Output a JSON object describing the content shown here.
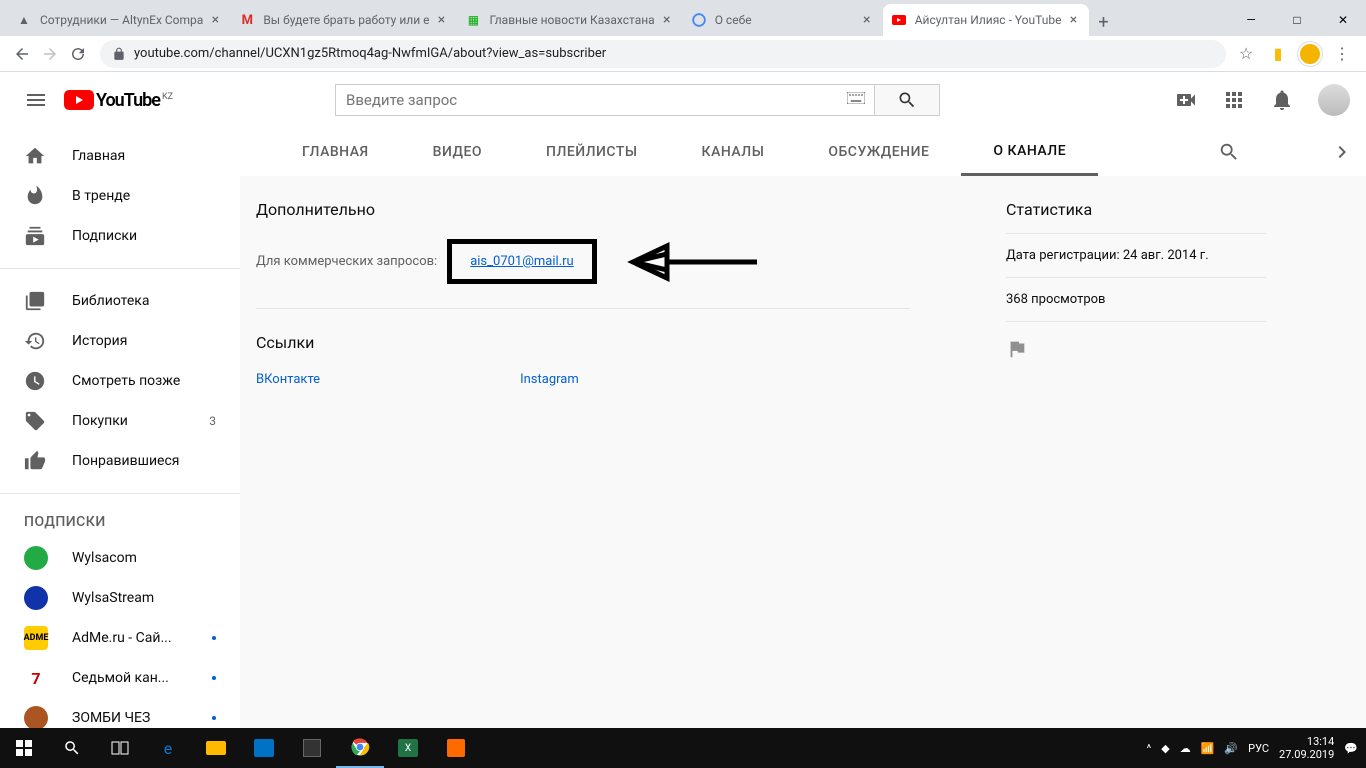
{
  "browser": {
    "tabs": [
      {
        "title": "Сотрудники — AltynEx Compa",
        "favicon": "altynex"
      },
      {
        "title": "Вы будете брать работу или е",
        "favicon": "gmail"
      },
      {
        "title": "Главные новости Казахстана",
        "favicon": "news"
      },
      {
        "title": "О себе",
        "favicon": "google"
      },
      {
        "title": "Айсултан Илияс - YouTube",
        "favicon": "youtube",
        "active": true
      }
    ],
    "url": "youtube.com/channel/UCXN1gz5Rtmoq4ag-NwfmIGA/about?view_as=subscriber"
  },
  "yt": {
    "logo_text": "YouTube",
    "logo_region": "KZ",
    "search_placeholder": "Введите запрос"
  },
  "sidebar": {
    "main": [
      {
        "icon": "home",
        "label": "Главная"
      },
      {
        "icon": "trending",
        "label": "В тренде"
      },
      {
        "icon": "subs",
        "label": "Подписки"
      }
    ],
    "lib": [
      {
        "icon": "library",
        "label": "Библиотека"
      },
      {
        "icon": "history",
        "label": "История"
      },
      {
        "icon": "later",
        "label": "Смотреть позже"
      },
      {
        "icon": "purchases",
        "label": "Покупки",
        "badge": "3"
      },
      {
        "icon": "liked",
        "label": "Понравившиеся"
      }
    ],
    "subs_title": "ПОДПИСКИ",
    "subs": [
      {
        "label": "Wylsacom",
        "color": "#2a4"
      },
      {
        "label": "WylsaStream",
        "color": "#13a"
      },
      {
        "label": "AdMe.ru - Сай...",
        "color": "#fc0",
        "dot": true
      },
      {
        "label": "Седьмой кан...",
        "color": "#c00",
        "dot": true
      },
      {
        "label": "ЗОМБИ ЧЕЗ",
        "color": "#a52",
        "dot": true
      }
    ]
  },
  "channel_tabs": [
    "ГЛАВНАЯ",
    "ВИДЕО",
    "ПЛЕЙЛИСТЫ",
    "КАНАЛЫ",
    "ОБСУЖДЕНИЕ",
    "О КАНАЛЕ"
  ],
  "about": {
    "additional_title": "Дополнительно",
    "biz_label": "Для коммерческих запросов:",
    "email": "ais_0701@mail.ru",
    "links_title": "Ссылки",
    "links": [
      "ВКонтакте",
      "Instagram"
    ],
    "stats_title": "Статистика",
    "reg_date": "Дата регистрации: 24 авг. 2014 г.",
    "views": "368 просмотров"
  },
  "taskbar": {
    "lang": "РУС",
    "time": "13:14",
    "date": "27.09.2019"
  }
}
